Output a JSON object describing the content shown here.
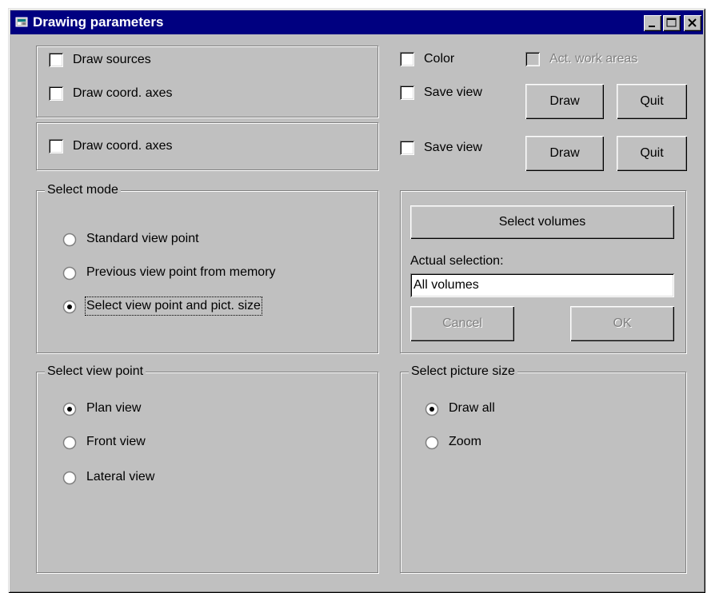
{
  "window": {
    "title": "Drawing parameters",
    "app_icon": "app-window-icon",
    "controls": [
      "minimize-icon",
      "maximize-icon",
      "close-icon"
    ]
  },
  "top_group": {
    "draw_sources": {
      "label": "Draw sources",
      "checked": false
    },
    "draw_coord_axes": {
      "label": "Draw coord. axes",
      "checked": false
    }
  },
  "top_right": {
    "color": {
      "label": "Color",
      "checked": false
    },
    "act_work_areas": {
      "label": "Act. work areas",
      "checked": false,
      "enabled": false
    },
    "save_view": {
      "label": "Save view",
      "checked": false
    },
    "draw_button": "Draw",
    "quit_button": "Quit"
  },
  "second_group": {
    "draw_coord_axes": {
      "label": "Draw coord. axes",
      "checked": false
    }
  },
  "second_right": {
    "save_view": {
      "label": "Save view",
      "checked": false
    },
    "draw_button": "Draw",
    "quit_button": "Quit"
  },
  "select_mode": {
    "legend": "Select mode",
    "options": [
      {
        "label": "Standard view point",
        "selected": false
      },
      {
        "label": "Previous view point from memory",
        "selected": false
      },
      {
        "label": "Select view point and pict. size",
        "selected": true
      }
    ]
  },
  "volumes": {
    "select_button": "Select volumes",
    "actual_label": "Actual selection:",
    "actual_value": "All volumes",
    "cancel_button": "Cancel",
    "ok_button": "OK"
  },
  "select_view_point": {
    "legend": "Select view point",
    "options": [
      {
        "label": "Plan view",
        "selected": true
      },
      {
        "label": "Front view",
        "selected": false
      },
      {
        "label": "Lateral view",
        "selected": false
      }
    ]
  },
  "select_picture_size": {
    "legend": "Select picture size",
    "options": [
      {
        "label": "Draw all",
        "selected": true
      },
      {
        "label": "Zoom",
        "selected": false
      }
    ]
  }
}
